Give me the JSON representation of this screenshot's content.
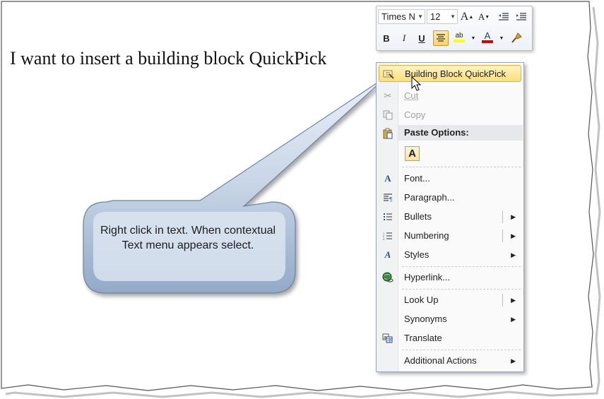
{
  "document": {
    "body_text": "I want to insert a building block QuickPick"
  },
  "mini_toolbar": {
    "font_name": "Times N",
    "font_size": "12",
    "grow_font": "A",
    "shrink_font": "A",
    "bold": "B",
    "italic": "I",
    "underline": "U",
    "highlight": "ab",
    "font_color": "A",
    "highlight_color": "#ffff00",
    "font_color_bar": "#e00000"
  },
  "context_menu": {
    "items": [
      {
        "label": "Building Block QuickPick",
        "icon": "building-block-icon"
      },
      {
        "label": "Cut",
        "icon": "scissors-icon"
      },
      {
        "label": "Copy",
        "icon": "copy-icon"
      },
      {
        "label": "Paste Options:"
      },
      {
        "label": "A"
      },
      {
        "label": "Font...",
        "icon": "font-icon"
      },
      {
        "label": "Paragraph...",
        "icon": "paragraph-icon"
      },
      {
        "label": "Bullets",
        "icon": "bullets-icon"
      },
      {
        "label": "Numbering",
        "icon": "numbering-icon"
      },
      {
        "label": "Styles",
        "icon": "styles-icon"
      },
      {
        "label": "Hyperlink...",
        "icon": "hyperlink-icon"
      },
      {
        "label": "Look Up"
      },
      {
        "label": "Synonyms"
      },
      {
        "label": "Translate",
        "icon": "translate-icon"
      },
      {
        "label": "Additional Actions"
      }
    ]
  },
  "callout": {
    "text": "Right click in text.  When contextual Text menu appears select."
  }
}
